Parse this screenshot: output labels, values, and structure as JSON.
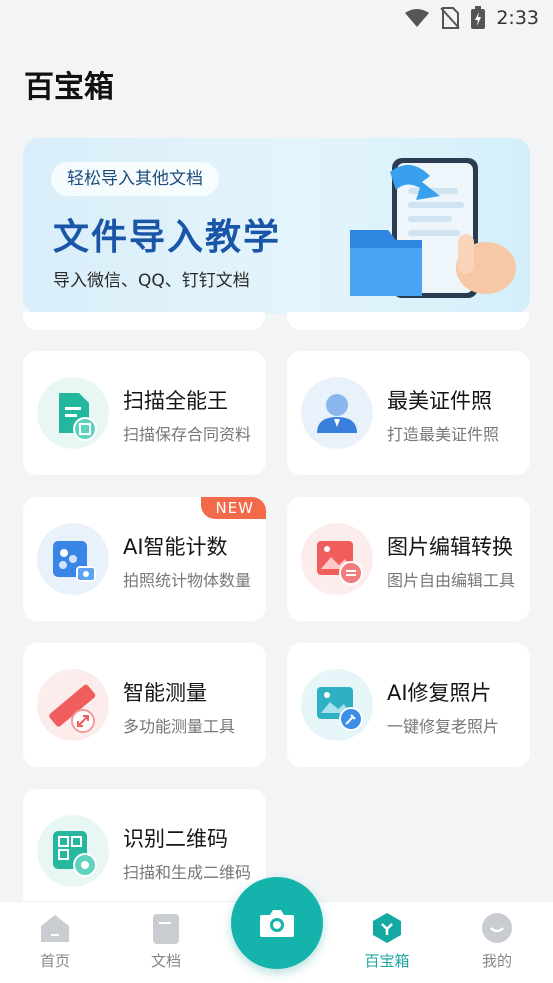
{
  "status_bar": {
    "time": "2:33"
  },
  "header": {
    "title": "百宝箱"
  },
  "banner": {
    "pill": "轻松导入其他文档",
    "title": "文件导入教学",
    "subtitle": "导入微信、QQ、钉钉文档"
  },
  "tools": [
    {
      "title": "扫描全能王",
      "desc": "扫描保存合同资料",
      "icon": "document-scan-icon"
    },
    {
      "title": "最美证件照",
      "desc": "打造最美证件照",
      "icon": "id-photo-icon"
    },
    {
      "title": "AI智能计数",
      "desc": "拍照统计物体数量",
      "icon": "ai-count-icon",
      "badge": "NEW"
    },
    {
      "title": "图片编辑转换",
      "desc": "图片自由编辑工具",
      "icon": "image-convert-icon"
    },
    {
      "title": "智能测量",
      "desc": "多功能测量工具",
      "icon": "ruler-icon"
    },
    {
      "title": "AI修复照片",
      "desc": "一键修复老照片",
      "icon": "photo-repair-icon"
    },
    {
      "title": "识别二维码",
      "desc": "扫描和生成二维码",
      "icon": "qr-code-icon"
    }
  ],
  "nav": {
    "items": [
      {
        "label": "首页",
        "icon": "home-icon"
      },
      {
        "label": "文档",
        "icon": "document-icon"
      },
      {
        "label": "百宝箱",
        "icon": "toolbox-icon",
        "active": true
      },
      {
        "label": "我的",
        "icon": "profile-icon"
      }
    ],
    "camera_icon": "camera-icon"
  },
  "colors": {
    "accent": "#14b3ab",
    "badge": "#f36a4a",
    "banner_title": "#1956a8"
  }
}
